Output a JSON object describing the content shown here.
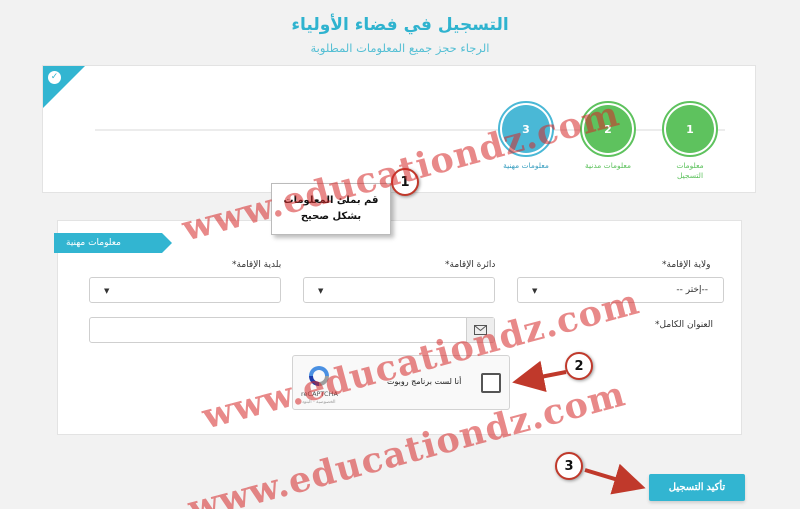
{
  "header": {
    "title": "التسجيل في فضاء الأولياء",
    "subtitle": "الرجاء حجز جميع المعلومات المطلوبة"
  },
  "stepper": {
    "steps": [
      {
        "number": "1",
        "label_line1": "معلومات",
        "label_line2": "التسجيل",
        "status": "complete"
      },
      {
        "number": "2",
        "label_line1": "معلومات مدنية",
        "label_line2": "",
        "status": "complete"
      },
      {
        "number": "3",
        "label_line1": "معلومات مهنية",
        "label_line2": "",
        "status": "current"
      }
    ]
  },
  "section": {
    "ribbon_label": "معلومات مهنية"
  },
  "form": {
    "wilaya_label": "ولاية الإقامة*",
    "wilaya_value": "--إختر --",
    "daira_label": "دائرة الإقامة*",
    "daira_value": "",
    "commune_label": "بلدية الإقامة*",
    "commune_value": "",
    "address_label": "العنوان الكامل*",
    "address_value": ""
  },
  "captcha": {
    "text": "أنا لست برنامج روبوت",
    "brand": "reCAPTCHA",
    "terms": "الخصوصية - البنود"
  },
  "submit_label": "تأكيد التسجيل",
  "annotations": {
    "badge1": "1",
    "badge2": "2",
    "badge3": "3",
    "note_line1": "قم بملئ المعلومات",
    "note_line2": "بشكل صحيح"
  },
  "watermark": "www.educationdz.com",
  "colors": {
    "accent": "#32b5d1",
    "step_complete": "#5ec25e",
    "annotation": "#c0392b",
    "watermark": "#d62828"
  }
}
